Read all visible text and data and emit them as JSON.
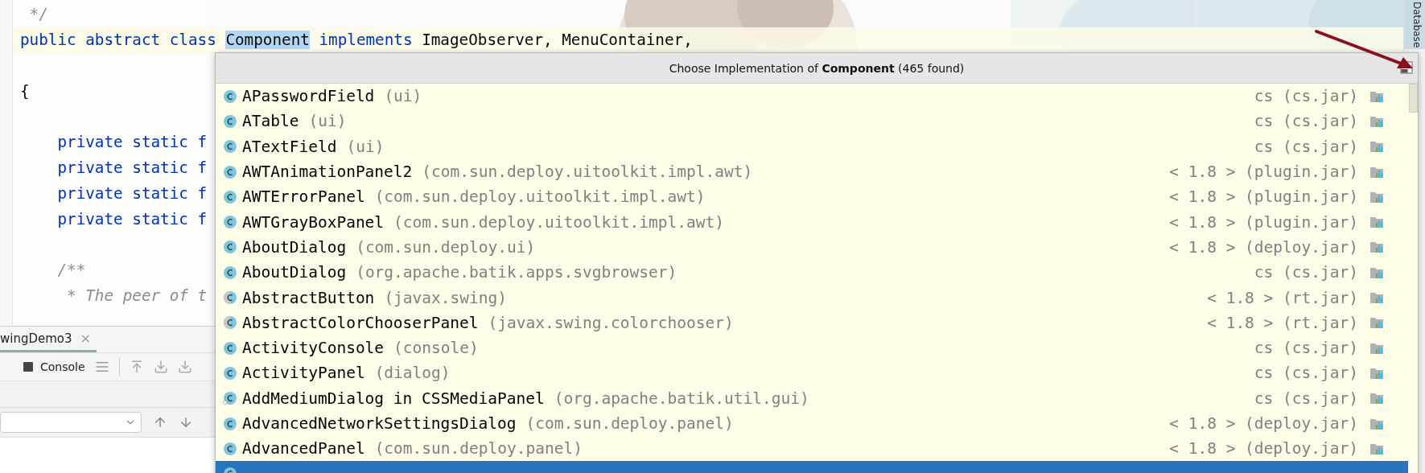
{
  "editor": {
    "lines": [
      {
        "kind": "code",
        "current": false,
        "tokens": [
          {
            "text": " */",
            "kind": "comment"
          }
        ]
      },
      {
        "kind": "code",
        "current": true,
        "tokens": [
          {
            "text": "public abstract class",
            "kind": "keyword"
          },
          {
            "text": "Component",
            "kind": "match"
          },
          {
            "text": "implements",
            "kind": "keyword"
          },
          {
            "text": "ImageObserver, MenuContainer,",
            "kind": "plain"
          }
        ]
      },
      {
        "kind": "blank"
      },
      {
        "kind": "code",
        "current": false,
        "tokens": [
          {
            "text": "{",
            "kind": "plain"
          }
        ]
      },
      {
        "kind": "blank"
      },
      {
        "kind": "code",
        "current": false,
        "tokens": [
          {
            "text": "    private static f",
            "kind": "keyword"
          }
        ]
      },
      {
        "kind": "code",
        "current": false,
        "tokens": [
          {
            "text": "    private static f",
            "kind": "keyword"
          }
        ]
      },
      {
        "kind": "code",
        "current": false,
        "tokens": [
          {
            "text": "    private static f",
            "kind": "keyword"
          }
        ]
      },
      {
        "kind": "code",
        "current": false,
        "tokens": [
          {
            "text": "    private static f",
            "kind": "keyword"
          }
        ]
      },
      {
        "kind": "blank"
      },
      {
        "kind": "code",
        "current": false,
        "tokens": [
          {
            "text": "    /**",
            "kind": "comment"
          }
        ]
      },
      {
        "kind": "code",
        "current": false,
        "tokens": [
          {
            "text": "     * The peer of t",
            "kind": "comment"
          }
        ]
      }
    ]
  },
  "side_tab": {
    "label": "Database"
  },
  "run_panel": {
    "tab": {
      "label": "wingDemo3",
      "close": "×"
    },
    "console_tab": {
      "label": "Console"
    }
  },
  "popup": {
    "title": "Choose Implementation of **Component** (465 found)",
    "items": [
      {
        "kind": "class",
        "name": "APasswordField",
        "package": "(ui)",
        "location": "cs (cs.jar)",
        "selected": false
      },
      {
        "kind": "class",
        "name": "ATable",
        "package": "(ui)",
        "location": "cs (cs.jar)",
        "selected": false
      },
      {
        "kind": "class",
        "name": "ATextField",
        "package": "(ui)",
        "location": "cs (cs.jar)",
        "selected": false
      },
      {
        "kind": "class",
        "name": "AWTAnimationPanel2",
        "package": "(com.sun.deploy.uitoolkit.impl.awt)",
        "location": "< 1.8 > (plugin.jar)",
        "selected": false
      },
      {
        "kind": "class",
        "name": "AWTErrorPanel",
        "package": "(com.sun.deploy.uitoolkit.impl.awt)",
        "location": "< 1.8 > (plugin.jar)",
        "selected": false
      },
      {
        "kind": "class",
        "name": "AWTGrayBoxPanel",
        "package": "(com.sun.deploy.uitoolkit.impl.awt)",
        "location": "< 1.8 > (plugin.jar)",
        "selected": false
      },
      {
        "kind": "class",
        "name": "AboutDialog",
        "package": "(com.sun.deploy.ui)",
        "location": "< 1.8 > (deploy.jar)",
        "selected": false
      },
      {
        "kind": "class",
        "name": "AboutDialog",
        "package": "(org.apache.batik.apps.svgbrowser)",
        "location": "cs (cs.jar)",
        "selected": false
      },
      {
        "kind": "abstract",
        "name": "AbstractButton",
        "package": "(javax.swing)",
        "location": "< 1.8 > (rt.jar)",
        "selected": false
      },
      {
        "kind": "abstract",
        "name": "AbstractColorChooserPanel",
        "package": "(javax.swing.colorchooser)",
        "location": "< 1.8 > (rt.jar)",
        "selected": false
      },
      {
        "kind": "class",
        "name": "ActivityConsole",
        "package": "(console)",
        "location": "cs (cs.jar)",
        "selected": false
      },
      {
        "kind": "class",
        "name": "ActivityPanel",
        "package": "(dialog)",
        "location": "cs (cs.jar)",
        "selected": false
      },
      {
        "kind": "inner",
        "name": "AddMediumDialog in CSSMediaPanel",
        "package": "(org.apache.batik.util.gui)",
        "location": "cs (cs.jar)",
        "selected": false
      },
      {
        "kind": "class",
        "name": "AdvancedNetworkSettingsDialog",
        "package": "(com.sun.deploy.panel)",
        "location": "< 1.8 > (deploy.jar)",
        "selected": false
      },
      {
        "kind": "class",
        "name": "AdvancedPanel",
        "package": "(com.sun.deploy.panel)",
        "location": "< 1.8 > (deploy.jar)",
        "selected": false
      },
      {
        "kind": "class",
        "selected": true
      }
    ]
  }
}
